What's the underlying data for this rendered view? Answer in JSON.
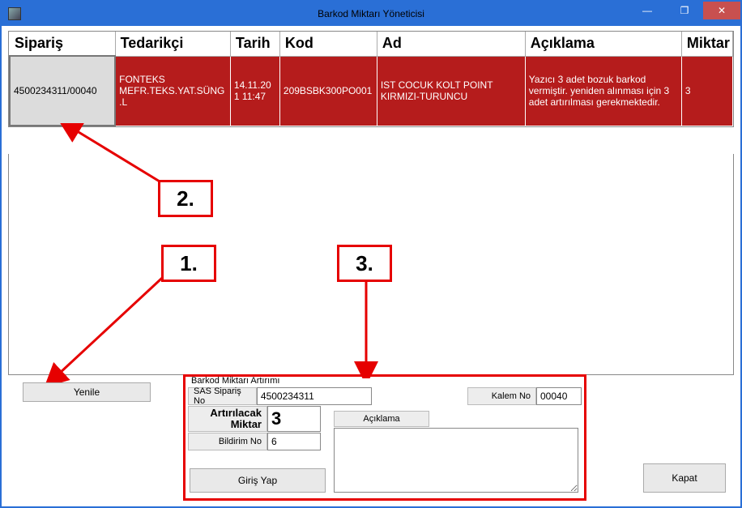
{
  "window": {
    "title": "Barkod Miktarı Yöneticisi",
    "min": "—",
    "restore": "❐",
    "close": "✕"
  },
  "grid": {
    "headers": [
      "Sipariş",
      "Tedarikçi",
      "Tarih",
      "Kod",
      "Ad",
      "Açıklama",
      "Miktar"
    ],
    "row": {
      "siparis": "4500234311/00040",
      "tedarikci": "FONTEKS MEFR.TEKS.YAT.SÜNG.L",
      "tarih": "14.11.201 11:47",
      "kod": "209BSBK300PO001",
      "ad": "IST COCUK KOLT POINT KIRMIZI-TURUNCU",
      "aciklama": "Yazıcı 3 adet bozuk barkod vermiştir. yeniden alınması için 3 adet artırılması gerekmektedir.",
      "miktar": "3"
    }
  },
  "annotations": {
    "a1": "1.",
    "a2": "2.",
    "a3": "3."
  },
  "buttons": {
    "yenile": "Yenile",
    "kapat": "Kapat",
    "giris": "Giriş Yap"
  },
  "form": {
    "title": "Barkod Miktarı Artırımı",
    "sas_label": "SAS Sipariş No",
    "sas": "4500234311",
    "kalem_label": "Kalem No",
    "kalem": "00040",
    "artir_label": "Artırılacak Miktar",
    "artir": "3",
    "bildirim_label": "Bildirim No",
    "bildirim": "6",
    "aciklama_label": "Açıklama",
    "aciklama": ""
  }
}
